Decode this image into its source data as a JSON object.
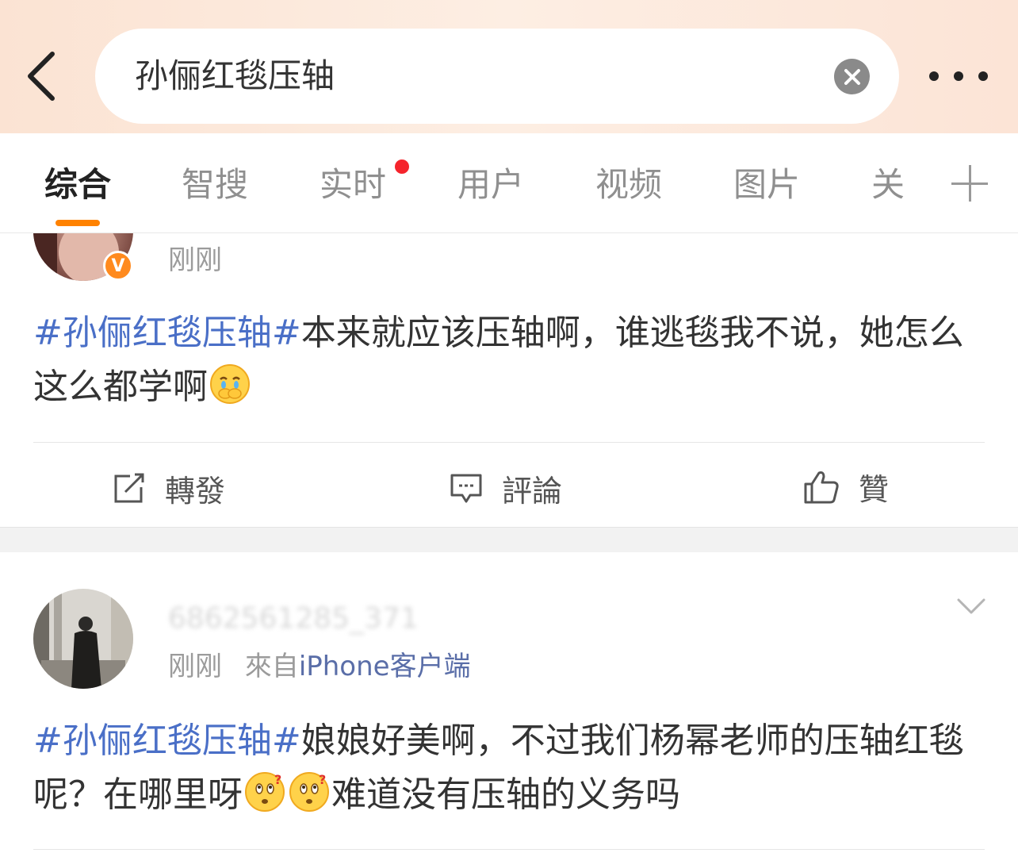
{
  "header": {
    "search_query": "孙俪红毯压轴"
  },
  "tabs": [
    "综合",
    "智搜",
    "实时",
    "用户",
    "视频",
    "图片",
    "关"
  ],
  "posts": [
    {
      "time": "刚刚",
      "text_topic": "#孙俪红毯压轴#",
      "text_body": "本来就应该压轴啊，谁逃毯我不说，她怎么这么都学啊",
      "badge": "V",
      "actions": {
        "repost": "轉發",
        "comment": "評論",
        "like": "贊"
      }
    },
    {
      "username": "6862561285_371",
      "time": "刚刚",
      "source_prefix": "來自",
      "source": "iPhone客户端",
      "text_topic": "#孙俪红毯压轴#",
      "text_body": "娘娘好美啊，不过我们杨幂老师的压轴红毯呢？在哪里呀",
      "text_tail": "难道没有压轴的义务吗"
    }
  ],
  "colors": {
    "accent": "#ff8200",
    "topic": "#4a6fc7",
    "red_dot": "#f5242c"
  }
}
